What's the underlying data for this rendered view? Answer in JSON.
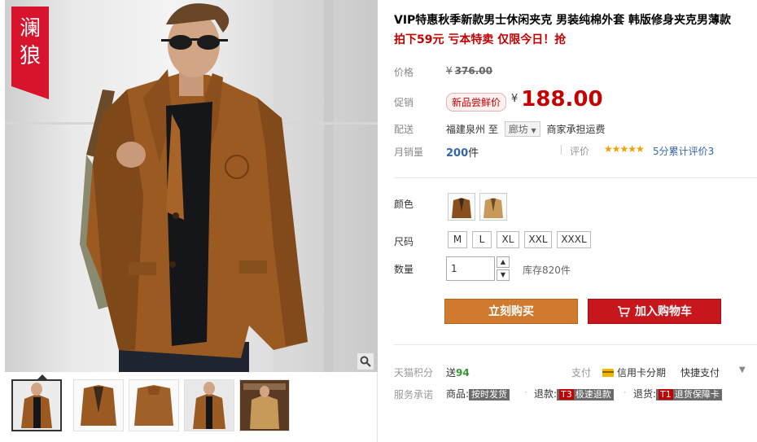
{
  "gallery": {
    "brand_chars": [
      "澜",
      "狼"
    ],
    "zoom_icon": "search-icon",
    "thumbnails": [
      {
        "alt": "thumb-1",
        "active": true
      },
      {
        "alt": "thumb-2",
        "active": false
      },
      {
        "alt": "thumb-3",
        "active": false
      },
      {
        "alt": "thumb-4",
        "active": false
      },
      {
        "alt": "thumb-5",
        "active": false
      }
    ]
  },
  "product": {
    "title": "VIP特惠秋季新款男士休闲夹克 男装纯棉外套 韩版修身夹克男薄款",
    "subtitle": "拍下59元 亏本特卖 仅限今日！抢"
  },
  "price": {
    "label": "价格",
    "currency": "¥",
    "original": "376.00"
  },
  "promo": {
    "label": "促销",
    "tag": "新品尝鲜价",
    "currency": "¥",
    "value": "188.00"
  },
  "shipping": {
    "label": "配送",
    "from": "福建泉州",
    "to_word": "至",
    "destination": "廊坊",
    "fee_text": "商家承担运费"
  },
  "sales": {
    "label": "月销量",
    "count": "200",
    "unit": "件",
    "review_label": "评价",
    "stars": "★★★★★",
    "review_text": "5分累计评价3"
  },
  "options": {
    "color_label": "颜色",
    "size_label": "尺码",
    "sizes": [
      "M",
      "L",
      "XL",
      "XXL",
      "XXXL"
    ],
    "qty_label": "数量",
    "qty_value": "1",
    "stock_text": "库存820件"
  },
  "actions": {
    "buy_now": "立刻购买",
    "add_to_cart": "加入购物车"
  },
  "bonus": {
    "label": "天猫积分",
    "text_prefix": "送",
    "points": "94",
    "pay_label": "支付",
    "card_pay": "信用卡分期",
    "quick_pay": "快捷支付"
  },
  "service": {
    "label": "服务承诺",
    "item1_prefix": "商品:",
    "item1_tag": "按时发货",
    "item2_prefix": "退款:",
    "item2_code": "T3",
    "item2_tag": "极速退款",
    "item3_prefix": "退货:",
    "item3_code": "T1",
    "item3_tag": "退货保障卡"
  },
  "colors": {
    "accent_red": "#c40000",
    "buy_now_bg": "#cf7a2e",
    "cart_bg": "#c8161d",
    "jacket_brown": "#9a5a22"
  }
}
